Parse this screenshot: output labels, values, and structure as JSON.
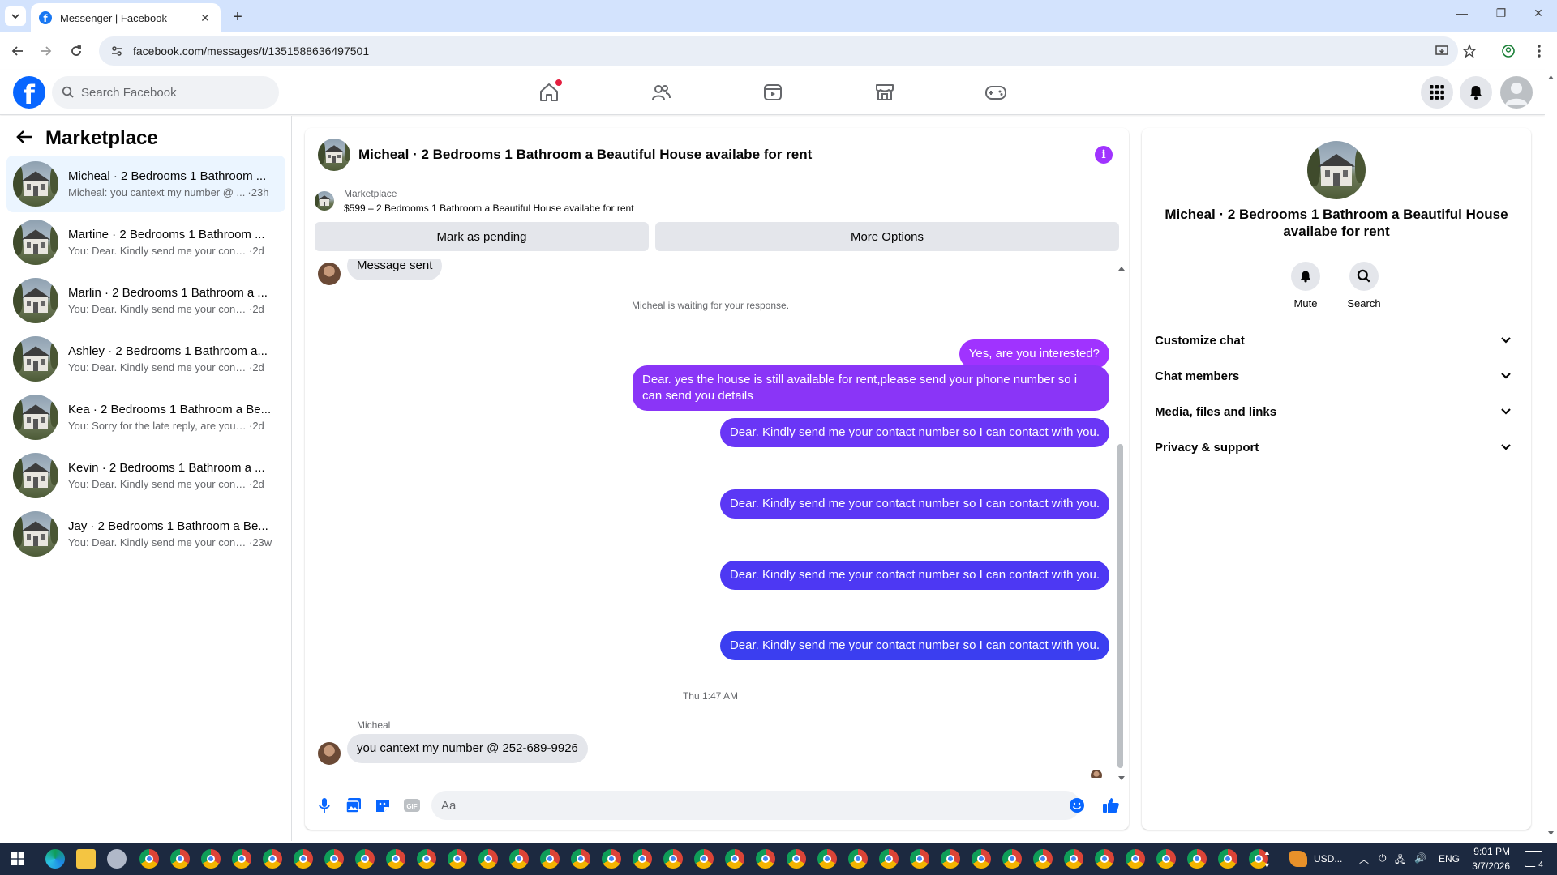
{
  "browser": {
    "tab_title": "Messenger | Facebook",
    "url": "facebook.com/messages/t/1351588636497501",
    "new_tab": "+",
    "close": "✕"
  },
  "fb": {
    "search_placeholder": "Search Facebook",
    "brand_color": "#0866ff"
  },
  "left": {
    "title": "Marketplace",
    "conversations": [
      {
        "name": "Micheal · 2 Bedrooms 1 Bathroom ...",
        "preview": "Micheal: you cantext my number @ ...",
        "time": "·23h"
      },
      {
        "name": "Martine · 2 Bedrooms 1 Bathroom ...",
        "preview": "You: Dear. Kindly send me your conta...",
        "time": "·2d"
      },
      {
        "name": "Marlin · 2 Bedrooms 1 Bathroom a ...",
        "preview": "You: Dear. Kindly send me your conta...",
        "time": "·2d"
      },
      {
        "name": "Ashley · 2 Bedrooms 1 Bathroom a...",
        "preview": "You: Dear. Kindly send me your conta...",
        "time": "·2d"
      },
      {
        "name": "Kea · 2 Bedrooms 1 Bathroom a Be...",
        "preview": "You: Sorry for the late reply, are you s...",
        "time": "·2d"
      },
      {
        "name": "Kevin · 2 Bedrooms 1 Bathroom a ...",
        "preview": "You: Dear. Kindly send me your conta...",
        "time": "·2d"
      },
      {
        "name": "Jay · 2 Bedrooms 1 Bathroom a Be...",
        "preview": "You: Dear. Kindly send me your cont...",
        "time": "·23w"
      }
    ]
  },
  "chat": {
    "title": "Micheal · 2 Bedrooms 1 Bathroom a Beautiful House availabe for rent",
    "marketplace_label": "Marketplace",
    "listing": "$599 – 2 Bedrooms 1 Bathroom a Beautiful House availabe for rent",
    "btn_pending": "Mark as pending",
    "btn_more": "More Options",
    "msg_sent": "Message sent",
    "waiting": "Micheal is waiting for your response.",
    "out_messages": [
      "Yes, are you interested?",
      "Dear. yes the house is still available for rent,please send your  phone number so i can send you details",
      "Dear. Kindly send me your contact number so I can contact with you.",
      "Dear. Kindly send me your contact number so I can contact with you.",
      "Dear. Kindly send me your contact number so I can contact with you.",
      "Dear. Kindly send me your contact number so I can contact with you."
    ],
    "timestamp": "Thu 1:47 AM",
    "sender": "Micheal",
    "in_message": "you cantext my number @ 252-689-9926",
    "composer_placeholder": "Aa",
    "bubble_purple": "#a033ff",
    "bubble_blue": "#5b37f5"
  },
  "info": {
    "title": "Micheal · 2 Bedrooms 1 Bathroom a Beautiful House availabe for rent",
    "mute": "Mute",
    "search": "Search",
    "rows": [
      "Customize chat",
      "Chat members",
      "Media, files and links",
      "Privacy & support"
    ]
  },
  "taskbar": {
    "currency": "USD...",
    "lang": "ENG",
    "time": "9:01 PM",
    "date": "3/7/2026",
    "notif_count": "4"
  }
}
